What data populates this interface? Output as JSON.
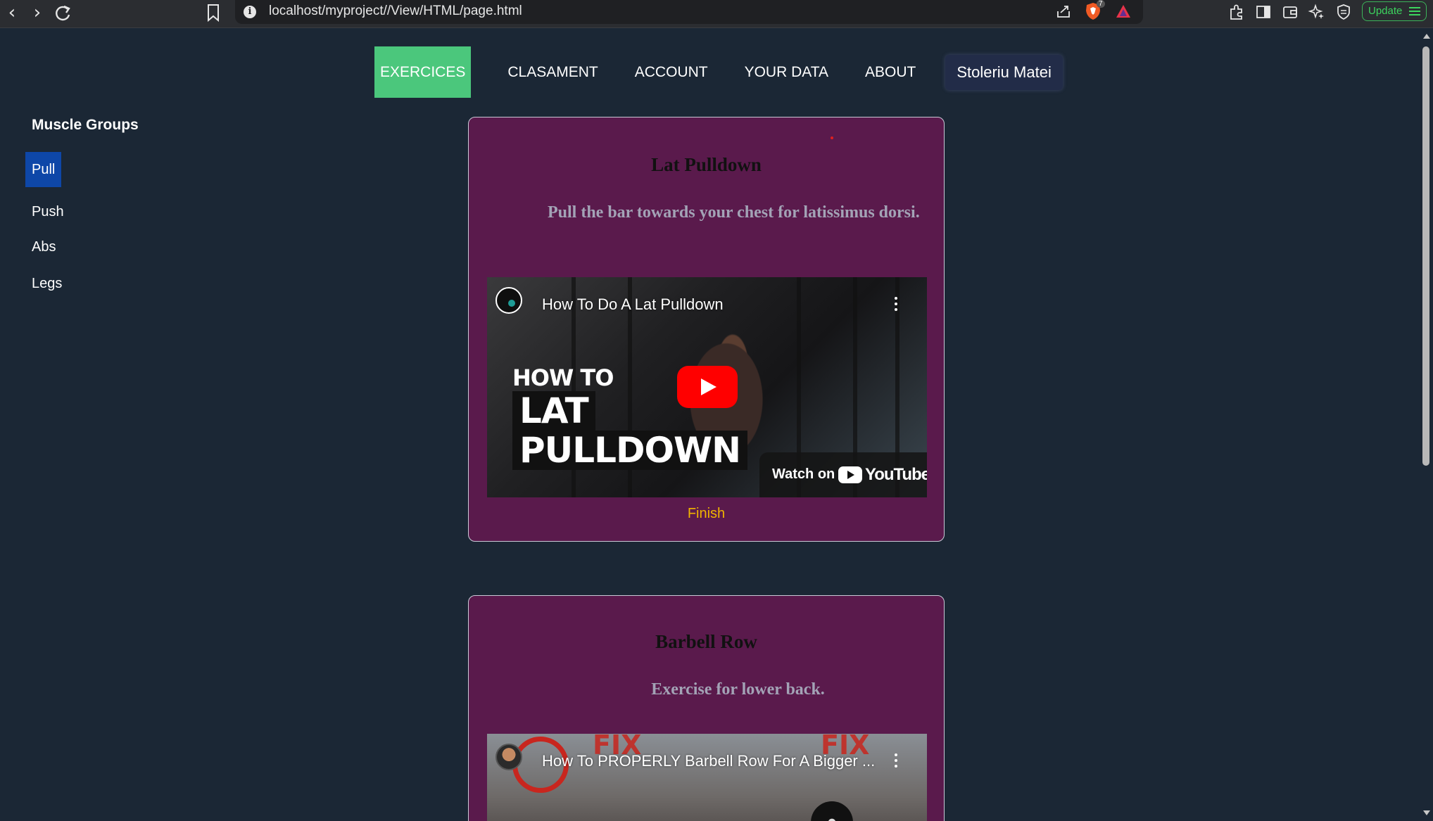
{
  "browser": {
    "url": "localhost/myproject//View/HTML/page.html",
    "shield_badge": "7",
    "update_label": "Update"
  },
  "nav": {
    "items": [
      {
        "label": "EXERCICES",
        "active": true
      },
      {
        "label": "CLASAMENT",
        "active": false
      },
      {
        "label": "ACCOUNT",
        "active": false
      },
      {
        "label": "YOUR DATA",
        "active": false
      },
      {
        "label": "ABOUT",
        "active": false
      }
    ],
    "user": "Stoleriu Matei"
  },
  "sidebar": {
    "title": "Muscle Groups",
    "items": [
      {
        "label": "Pull",
        "active": true
      },
      {
        "label": "Push",
        "active": false
      },
      {
        "label": "Abs",
        "active": false
      },
      {
        "label": "Legs",
        "active": false
      }
    ]
  },
  "exercises": [
    {
      "title": "Lat Pulldown",
      "description": "Pull the bar towards your chest for latissimus dorsi.",
      "video_title": "How To Do A Lat Pulldown",
      "thumb_line1": "HOW TO",
      "thumb_line2": "LAT",
      "thumb_line3": "PULLDOWN",
      "watch_on": "Watch on",
      "youtube": "YouTube",
      "finish_label": "Finish"
    },
    {
      "title": "Barbell Row",
      "description": "Exercise for lower back.",
      "video_title": "How To PROPERLY Barbell Row For A Bigger ...",
      "thumb_fix": "FIX"
    }
  ],
  "colors": {
    "background": "#1b2735",
    "nav_active": "#4bc77c",
    "sidebar_active": "#0e47a8",
    "card": "#5a1a4c",
    "finish": "#f0b400",
    "youtube_red": "#ff0000"
  }
}
